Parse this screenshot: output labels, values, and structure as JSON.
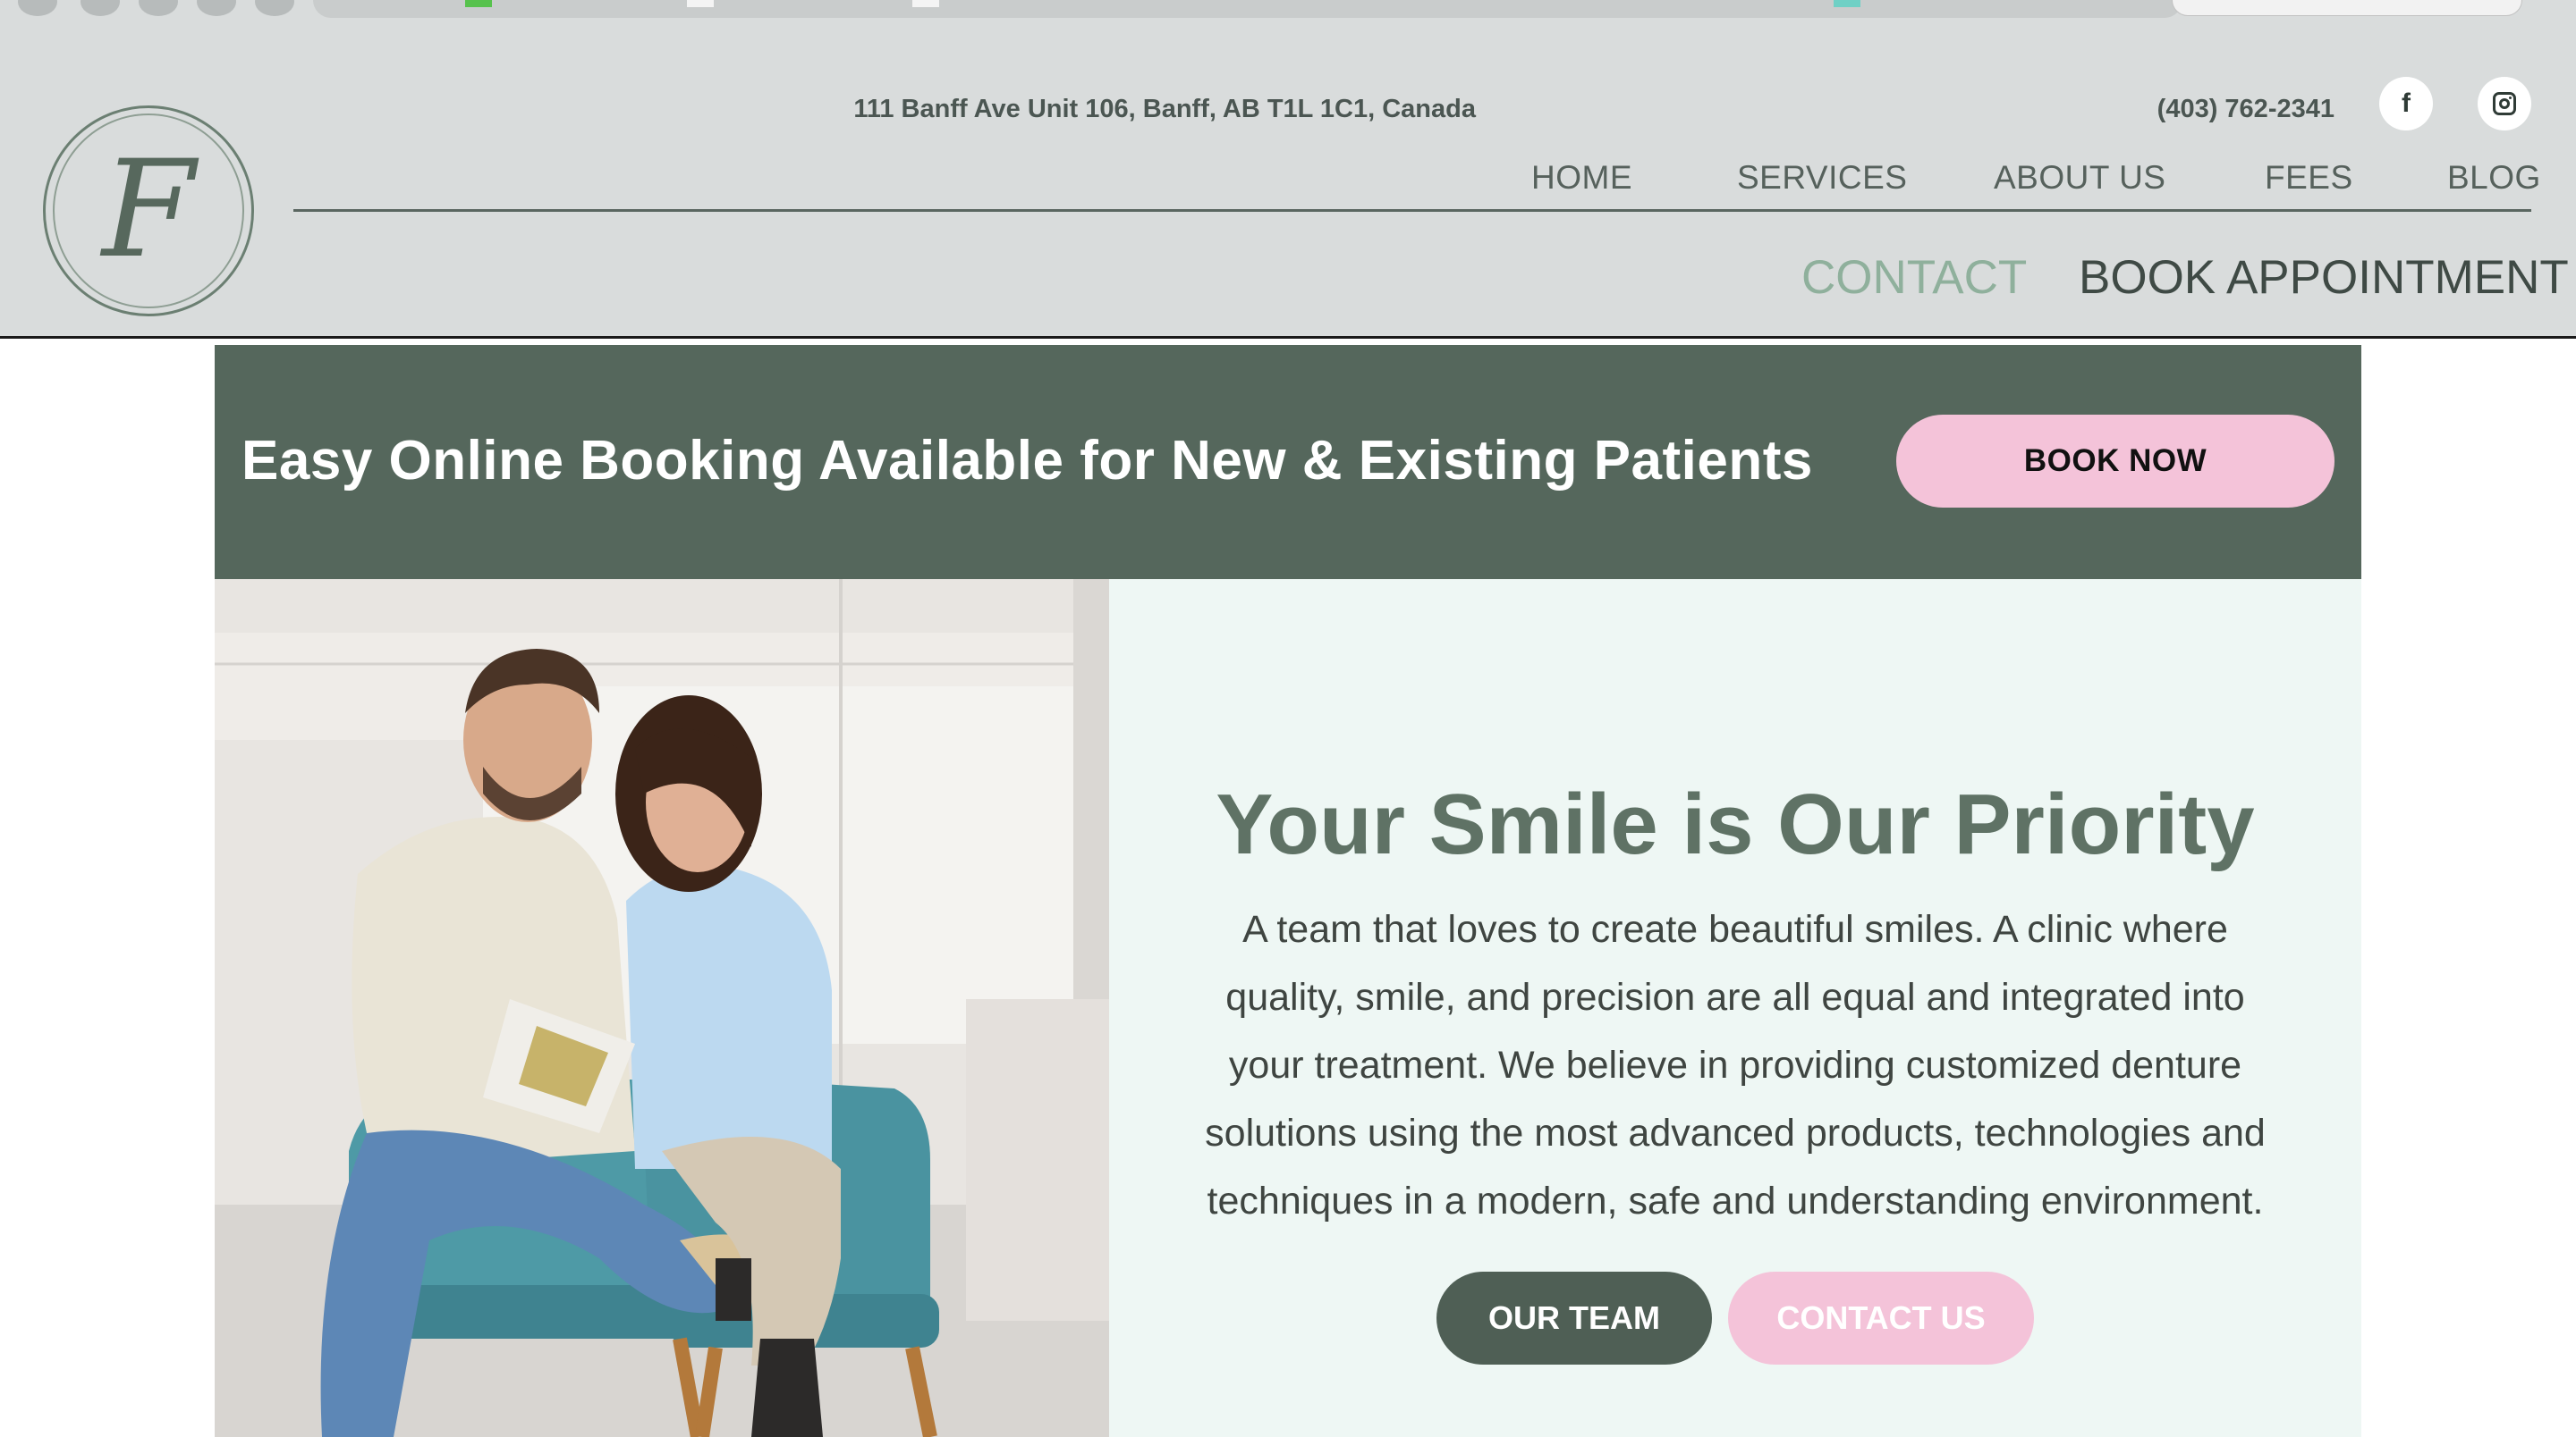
{
  "header": {
    "address": "111 Banff Ave Unit 106, Banff, AB T1L 1C1, Canada",
    "phone": "(403) 762-2341",
    "logo_letter": "F",
    "social": [
      {
        "icon": "facebook-icon",
        "glyph": "f"
      },
      {
        "icon": "instagram-icon"
      }
    ],
    "nav": {
      "home": "HOME",
      "services": "SERVICES",
      "about": "ABOUT US",
      "fees": "FEES",
      "blog": "BLOG",
      "contact": "CONTACT",
      "book_appointment": "BOOK APPOINTMENT"
    }
  },
  "banner": {
    "text": "Easy Online Booking Available for New & Existing Patients",
    "button": "BOOK NOW"
  },
  "hero": {
    "title": "Your Smile is Our Priority",
    "body": "A team that loves to create beautiful smiles. A clinic where quality, smile, and precision are all equal and integrated into your treatment. We believe in providing customized denture solutions using the most advanced products, technologies and techniques in a modern, safe and understanding environment.",
    "buttons": {
      "team": "OUR TEAM",
      "contact": "CONTACT US"
    }
  },
  "colors": {
    "header_bg": "#d9dcdc",
    "banner_bg": "#55675c",
    "accent_pink": "#f4c3d9",
    "panel_bg": "#eef7f4",
    "title_green": "#5f7265",
    "contact_nav": "#8fb09c"
  }
}
